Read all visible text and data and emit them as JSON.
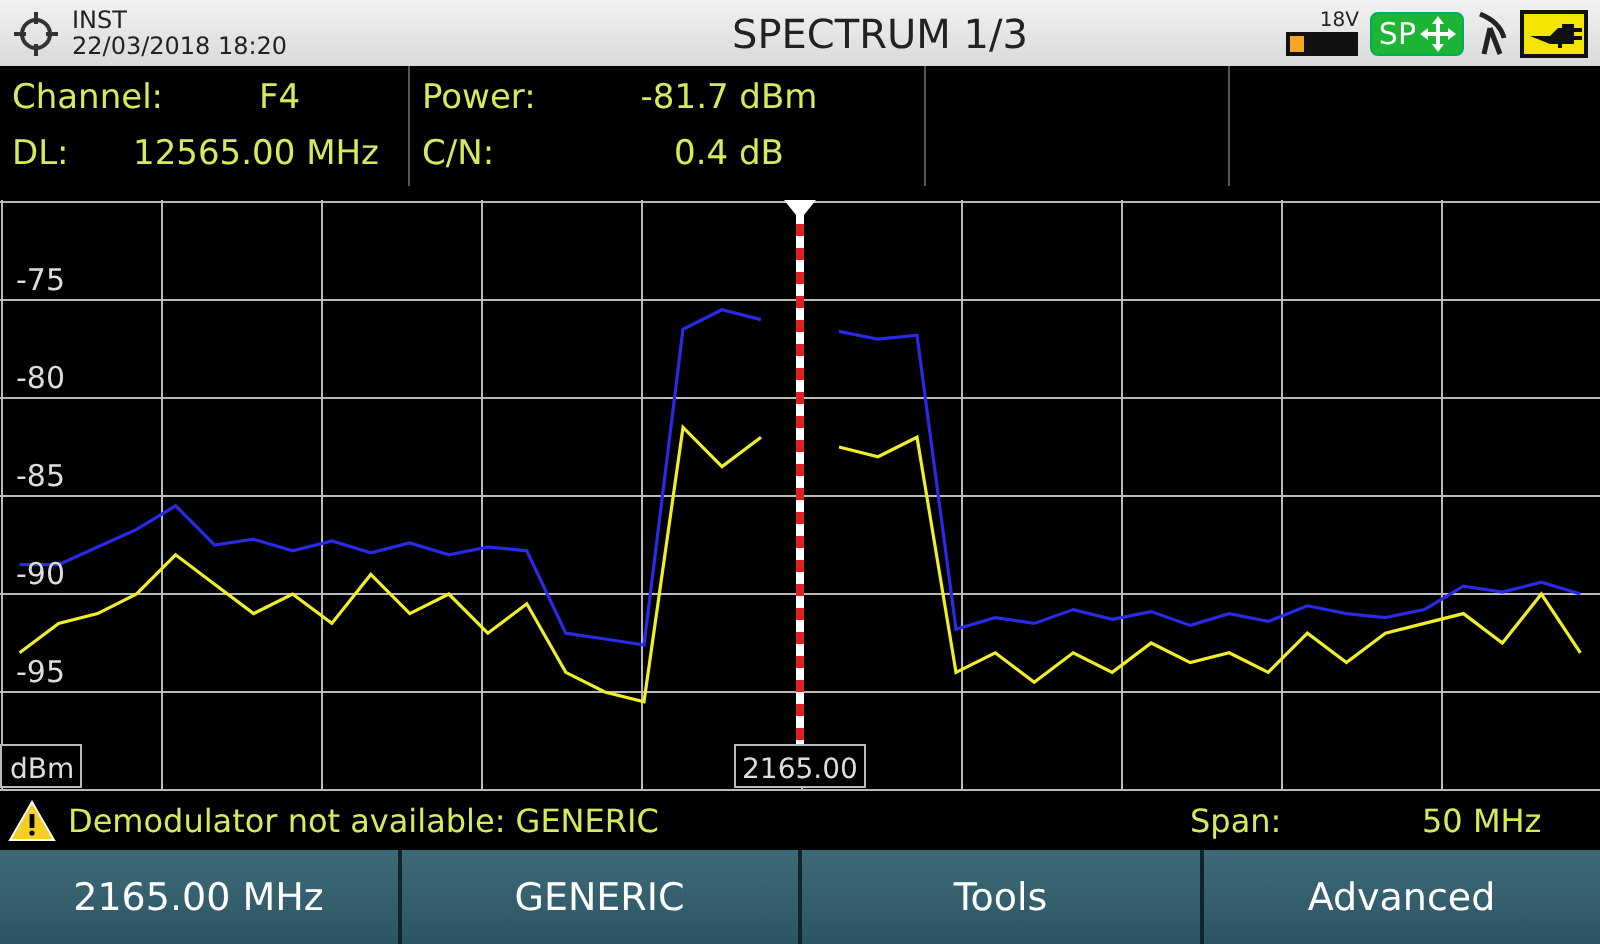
{
  "header": {
    "mode": "INST",
    "datetime": "22/03/2018 18:20",
    "title": "SPECTRUM 1/3",
    "voltage": "18V",
    "sp_badge": "SP"
  },
  "measurements": [
    {
      "label": "Channel:",
      "value": "F4"
    },
    {
      "label": "DL:",
      "value": "12565.00 MHz"
    },
    {
      "label": "Power:",
      "value": "-81.7 dBm"
    },
    {
      "label": "C/N:",
      "value": "0.4 dB"
    }
  ],
  "chart": {
    "marker_label": "2165.00",
    "chart_data": {
      "type": "line",
      "ylabel": "dBm",
      "ylim": [
        -100,
        -70
      ],
      "grid": true,
      "yticks": [
        -75,
        -80,
        -85,
        -90,
        -95
      ],
      "series": [
        {
          "color": "#2a2ae8",
          "values": [
            -88.5,
            -88.5,
            -87.6,
            -86.7,
            -85.5,
            -87.5,
            -87.2,
            -87.8,
            -87.3,
            -87.9,
            -87.4,
            -88,
            -87.6,
            -87.8,
            -92,
            -92.3,
            -92.6,
            -76.5,
            -75.5,
            -76,
            null,
            -76.6,
            -77,
            -76.8,
            -91.8,
            -91.2,
            -91.5,
            -90.8,
            -91.3,
            -90.9,
            -91.6,
            -91,
            -91.4,
            -90.6,
            -91,
            -91.2,
            -90.8,
            -89.6,
            -89.9,
            -89.4,
            -90
          ]
        },
        {
          "color": "#f0ee28",
          "values": [
            -93,
            -91.5,
            -91,
            -90,
            -88,
            -89.5,
            -91,
            -90,
            -91.5,
            -89,
            -91,
            -90,
            -92,
            -90.5,
            -94,
            -95,
            -95.5,
            -81.5,
            -83.5,
            -82,
            null,
            -82.5,
            -83,
            -82,
            -94,
            -93,
            -94.5,
            -93,
            -94,
            -92.5,
            -93.5,
            -93,
            -94,
            -92,
            -93.5,
            -92,
            -91.5,
            -91,
            -92.5,
            -90,
            -93
          ]
        }
      ]
    }
  },
  "status": {
    "warning": "Demodulator not available: GENERIC",
    "span_label": "Span:",
    "span_value": "50 MHz"
  },
  "softkeys": [
    "2165.00 MHz",
    "GENERIC",
    "Tools",
    "Advanced"
  ]
}
